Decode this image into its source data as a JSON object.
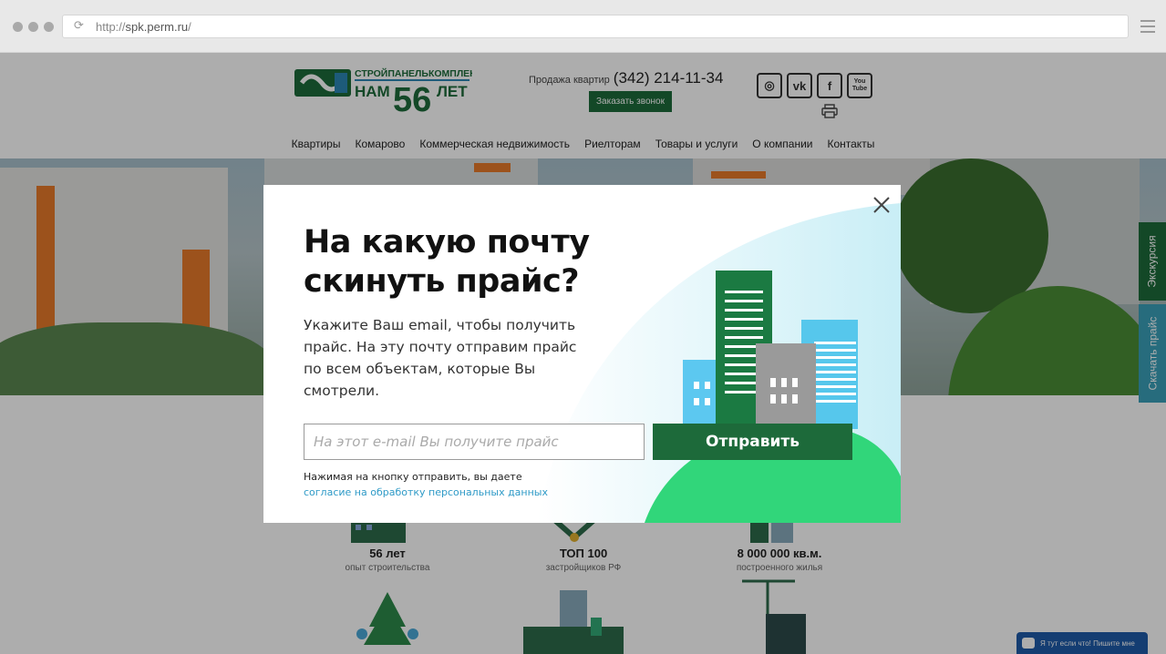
{
  "browser": {
    "url_protocol": "http://",
    "url_host": "spk.perm.ru",
    "url_path": "/"
  },
  "header": {
    "logo_name": "СТРОЙПАНЕЛЬКОМПЛЕКТ",
    "logo_tagline_nam": "НАМ",
    "logo_tagline_years": "56",
    "logo_tagline_let": "ЛЕТ",
    "sales_label": "Продажа квартир",
    "sales_phone": "(342) 214-11-34",
    "callback_label": "Заказать звонок",
    "socials": [
      {
        "icon": "instagram-icon",
        "glyph": "◎"
      },
      {
        "icon": "vk-icon",
        "glyph": "vk"
      },
      {
        "icon": "facebook-icon",
        "glyph": "f"
      },
      {
        "icon": "youtube-icon",
        "glyph": "You Tube"
      }
    ]
  },
  "nav": {
    "items": [
      "Квартиры",
      "Комарово",
      "Коммерческая недвижимость",
      "Риелторам",
      "Товары и услуги",
      "О компании",
      "Контакты"
    ]
  },
  "features": [
    {
      "title": "56 лет",
      "subtitle": "опыт строительства"
    },
    {
      "title": "ТОП 100",
      "subtitle": "застройщиков РФ"
    },
    {
      "title": "8 000 000 кв.м.",
      "subtitle": "построенного жилья"
    }
  ],
  "side_tabs": {
    "tour": "Экскурсия",
    "price": "Скачать прайс"
  },
  "chat": {
    "label": "Я тут если что! Пишите мне"
  },
  "modal": {
    "title": "На какую почту скинуть прайс?",
    "description": "Укажите Ваш email, чтобы получить прайс. На эту почту отправим прайс по всем объектам, которые Вы смотрели.",
    "email_placeholder": "На этот e-mail Вы получите прайс",
    "submit_label": "Отправить",
    "consent_text": "Нажимая на кнопку отправить, вы даете",
    "consent_link": "согласие на обработку персональных данных"
  },
  "colors": {
    "brand_green": "#1d6a3a",
    "link_blue": "#2e9ac7",
    "tour_tab": "#1d6a3a",
    "price_tab": "#3aa0b8"
  }
}
